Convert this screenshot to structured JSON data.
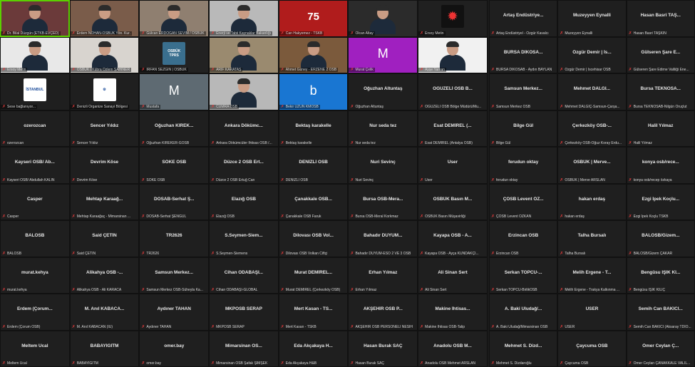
{
  "meeting": {
    "left_tiles": [
      {
        "name": "",
        "sub": "Dr. Bilal Düzgün (ETKB-EVÇED)",
        "kind": "person",
        "bg": "#6b3a3a",
        "active": true,
        "icon": "person-silhouette"
      },
      {
        "name": "",
        "sub": "Erdem NOHAN-OSBÜK Yön. Kur.",
        "kind": "person",
        "bg": "#7a5c4a",
        "icon": "person-silhouette"
      },
      {
        "name": "",
        "sub": "Gülcan ERDOĞAN SEVİM / OSBÜK",
        "kind": "person",
        "bg": "#8f7f70",
        "icon": "person-silhouette"
      },
      {
        "name": "",
        "sub": "Enerji ve Tabii Kaynaklar Bakanlığı",
        "kind": "person",
        "bg": "#b9b9b9",
        "icon": "person-silhouette"
      },
      {
        "name": "",
        "sub": "Can Hakyemez - TSKB",
        "kind": "logo",
        "bg": "#b01c1c",
        "logo": "75",
        "icon": "anniversary-logo"
      },
      {
        "name": "",
        "sub": "Olcan Altay",
        "kind": "person",
        "bg": "#2b2b2b",
        "icon": "person-silhouette"
      },
      {
        "name": "",
        "sub": "Ersoy Metin",
        "kind": "logo",
        "bg": "#202020",
        "logo": "✹",
        "icon": "emblem-logo"
      },
      {
        "name": "",
        "sub": "Ersoy Metin",
        "kind": "person",
        "bg": "#e8e8e8",
        "icon": "person-silhouette"
      },
      {
        "name": "",
        "sub": "OSBÜK | Kübra Özlem ŞAHİNER",
        "kind": "person",
        "bg": "#d8d4cf",
        "icon": "person-silhouette"
      },
      {
        "name": "",
        "sub": "İRFAN SEZGİN | OSBÜK",
        "kind": "logo",
        "bg": "#222",
        "logo": "OSBÜK TPRS",
        "icon": "osbuk-logo"
      },
      {
        "name": "",
        "sub": "ARİF KARATAŞ",
        "kind": "person",
        "bg": "#9a8a6f",
        "icon": "person-silhouette"
      },
      {
        "name": "",
        "sub": "Ahmet Güney - ERZENE 2 OSB",
        "kind": "person",
        "bg": "#7b5a3c",
        "icon": "person-silhouette"
      },
      {
        "name": "",
        "sub": "Murat Çelik",
        "kind": "avatar",
        "bg": "#a020c0",
        "letter": "M",
        "icon": "letter-avatar"
      },
      {
        "name": "",
        "sub": "Ayşe Yaman",
        "kind": "person",
        "bg": "#f1f1f1",
        "icon": "person-silhouette"
      },
      {
        "name": "",
        "sub": "Sese bağlanıyor...",
        "kind": "logo",
        "bg": "#1f1f1f",
        "logo": "İSTANBUL",
        "icon": "istanbul-osb-logo"
      },
      {
        "name": "",
        "sub": "Denizli Organize Sanayi Bölgesi",
        "kind": "logo",
        "bg": "#1f1f1f",
        "logo": "⚙",
        "icon": "gear-logo"
      },
      {
        "name": "",
        "sub": "Mustafa",
        "kind": "avatar",
        "bg": "#5e6a72",
        "letter": "M",
        "icon": "letter-avatar"
      },
      {
        "name": "",
        "sub": "CUMRA OSB",
        "kind": "person",
        "bg": "#b8b8b8",
        "icon": "person-silhouette"
      },
      {
        "name": "",
        "sub": "Bekir UZUN KMOSB",
        "kind": "avatar",
        "bg": "#1976d2",
        "letter": "b",
        "icon": "letter-avatar"
      },
      {
        "name": "Oğuzhan Altuntaş",
        "sub": "Oğuzhan Altuntaş",
        "kind": "text"
      },
      {
        "name": "OĞUZELİ OSB B...",
        "sub": "OĞUZELİ OSB Bölge Müdürü/Mu...",
        "kind": "text"
      },
      {
        "name": "ozerozcan",
        "sub": "ozerozcan",
        "kind": "text"
      },
      {
        "name": "Sencer Yıldız",
        "sub": "Sencer Yıldız",
        "kind": "text"
      },
      {
        "name": "Oğuzhan KIREK...",
        "sub": "Oğuzhan KIREKER-GOSB",
        "kind": "text"
      },
      {
        "name": "Ankara Dökümc...",
        "sub": "Ankara Dökümcüler İhtisas OSB /...",
        "kind": "text"
      },
      {
        "name": "Bektaş karakelle",
        "sub": "Bektaş karakelle",
        "kind": "text"
      },
      {
        "name": "Nur seda tez",
        "sub": "Nur seda tez",
        "kind": "text"
      },
      {
        "name": "Esat DEMİREL (...",
        "sub": "Esat DEMİREL (Antalya OSB)",
        "kind": "text"
      },
      {
        "name": "Kayseri OSB/ Ab...",
        "sub": "Kayseri OSB/ Abdullah KALIN",
        "kind": "text"
      },
      {
        "name": "Devrim Köse",
        "sub": "Devrim Köse",
        "kind": "text"
      },
      {
        "name": "SÖKE OSB",
        "sub": "SÖKE OSB",
        "kind": "text"
      },
      {
        "name": "Düzce 2 OSB Ert...",
        "sub": "Düzce 2 OSB Ertuğ Can",
        "kind": "text"
      },
      {
        "name": "DENİZLİ OSB",
        "sub": "DENİZLİ OSB",
        "kind": "text"
      },
      {
        "name": "Nuri Sevinç",
        "sub": "Nuri Sevinç",
        "kind": "text"
      },
      {
        "name": "User",
        "sub": "User",
        "kind": "text"
      },
      {
        "name": "Casper",
        "sub": "Casper",
        "kind": "text"
      },
      {
        "name": "Mehtap Karaağ...",
        "sub": "Mehtap Karaağaç - Mimarsinan ...",
        "kind": "text"
      },
      {
        "name": "DOSAB-Serhat Ş...",
        "sub": "DOSAB-Serhat ŞENGÜL",
        "kind": "text"
      },
      {
        "name": "Elazığ OSB",
        "sub": "Elazığ OSB",
        "kind": "text"
      },
      {
        "name": "Çanakkale OSB...",
        "sub": "Çanakkale OSB Faruk",
        "kind": "text"
      },
      {
        "name": "Bursa OSB-Mera...",
        "sub": "Bursa OSB-Meral Korkmaz",
        "kind": "text"
      },
      {
        "name": "OSBÜK Basın M...",
        "sub": "OSBÜK Basın Müşavirliği",
        "kind": "text"
      },
      {
        "name": "BALOSB",
        "sub": "BALOSB",
        "kind": "text"
      },
      {
        "name": "Said ÇETİN",
        "sub": "Said ÇETİN",
        "kind": "text"
      },
      {
        "name": "TR2626",
        "sub": "TR2626",
        "kind": "text"
      },
      {
        "name": "S.Seymen-Siem...",
        "sub": "S.Seymen-Siemens",
        "kind": "text"
      },
      {
        "name": "Dilovası OSB Vol...",
        "sub": "Dilovası OSB Volkan Ciftçi",
        "kind": "text"
      },
      {
        "name": "Bahadır DUYUM...",
        "sub": "Bahadır DUYUM-ESO 2 VE 3 OSB",
        "kind": "text"
      },
      {
        "name": "Kayapa OSB - A...",
        "sub": "Kayapa OSB - Ayça KUNDAKÇI...",
        "kind": "text"
      },
      {
        "name": "murat.kehya",
        "sub": "murat.kehya",
        "kind": "text"
      },
      {
        "name": "Alikahya OSB -...",
        "sub": "Alikahya OSB - Ali KARACA",
        "kind": "text"
      },
      {
        "name": "Samsun Merkez...",
        "sub": "Samsun Merkez OSB-Süheyla Ka...",
        "kind": "text"
      },
      {
        "name": "Cihan ODABAŞI...",
        "sub": "Cihan ODABAŞI-GLOBAL",
        "kind": "text"
      },
      {
        "name": "Murat DEMİREL...",
        "sub": "Murat DEMİREL (Çerkezköy OSB)",
        "kind": "text"
      },
      {
        "name": "Erhan Yılmaz",
        "sub": "Erhan Yılmaz",
        "kind": "text"
      },
      {
        "name": "Ali Sinan Sert",
        "sub": "Ali Sinan Sert",
        "kind": "text"
      },
      {
        "name": "Erdem (Çorum...",
        "sub": "Erdem (Çorum OSB)",
        "kind": "text"
      },
      {
        "name": "M. Anıl KABACA...",
        "sub": "M. Anıl KABACAN (IU)",
        "kind": "text"
      },
      {
        "name": "Aydıner TAHAN",
        "sub": "Aydıner TAHAN",
        "kind": "text"
      },
      {
        "name": "MKPOSB SERAP",
        "sub": "MKPOSB SERAP",
        "kind": "text"
      },
      {
        "name": "Mert Kasan - TS...",
        "sub": "Mert Kasan - TSKB",
        "kind": "text"
      },
      {
        "name": "AKŞEHİR OSB P...",
        "sub": "AKŞEHİR OSB PERSONELİ NESİH",
        "kind": "text"
      },
      {
        "name": "Makine İhtisas...",
        "sub": "Makine İhtisas OSB-Talip",
        "kind": "text"
      },
      {
        "name": "Meltem Ucal",
        "sub": "Meltem Ucal",
        "kind": "text"
      },
      {
        "name": "BABAYIGITM",
        "sub": "BABAYIGITM",
        "kind": "text"
      },
      {
        "name": "omer.bay",
        "sub": "omer.bay",
        "kind": "text"
      },
      {
        "name": "Mimarsinan OS...",
        "sub": "Mimarsinan OSB Şafak ŞİMŞEK",
        "kind": "text"
      },
      {
        "name": "Eda Akçakaya H...",
        "sub": "Eda Akçakaya H&B",
        "kind": "text"
      },
      {
        "name": "Hasan Burak SAÇ",
        "sub": "Hasan Burak SAÇ",
        "kind": "text"
      },
      {
        "name": "Anadolu OSB M...",
        "sub": "Anadolu OSB Mehmet ARSLAN",
        "kind": "text"
      }
    ],
    "right_tiles": [
      {
        "name": "Artaş Endüstriye...",
        "sub": "Artaş Endüstriyel - Özgür Kavalcı"
      },
      {
        "name": "Muzeyyen Eynalli",
        "sub": "Muzeyyen Eynalli"
      },
      {
        "name": "Hasan Basri TAŞ...",
        "sub": "Hasan Basri TAŞKIN"
      },
      {
        "name": "BURSA DİKOSA...",
        "sub": "BURSA DİKOSAB - Aydın BAYLAN"
      },
      {
        "name": "Özgür Demir | İs...",
        "sub": "Özgür Demir | İscehisar OSB"
      },
      {
        "name": "Gülseren Şare E...",
        "sub": "Gülseren Şare Edirne Valiliği Ene..."
      },
      {
        "name": "Samsun Merkez...",
        "sub": "Samsun Merkez OSB"
      },
      {
        "name": "Mehmet DALGI...",
        "sub": "Mehmet DALGIÇ-Samsun-Çarşa..."
      },
      {
        "name": "Bursa TEKNOSA...",
        "sub": "Bursa TEKNOSAB-Nilgün Oruçlut"
      },
      {
        "name": "Bilge Gül",
        "sub": "Bilge Gül"
      },
      {
        "name": "Çerkezköy OSB-...",
        "sub": "Çerkezköy OSB-Oğuz Koray Erdu..."
      },
      {
        "name": "Halil Yılmaz",
        "sub": "Halil Yılmaz"
      },
      {
        "name": "ferudun oktay",
        "sub": "ferudun oktay"
      },
      {
        "name": "OSBÜK | Merve...",
        "sub": "OSBÜK | Merve ARSLAN"
      },
      {
        "name": "konya osb/rece...",
        "sub": "konya osb/recep özkaya"
      },
      {
        "name": "ÇOSB Levent ÖZ...",
        "sub": "ÇOSB Levent ÖZKAN"
      },
      {
        "name": "hakan erdaş",
        "sub": "hakan erdaş"
      },
      {
        "name": "Ezgi İpek Koçlu...",
        "sub": "Ezgi İpek Koçlu TSKB"
      },
      {
        "name": "Erzincan OSB",
        "sub": "Erzincan OSB"
      },
      {
        "name": "Talha Bursalı",
        "sub": "Talha Bursalı"
      },
      {
        "name": "BALOSB/Gizem...",
        "sub": "BALOSB/Gizem ÇAKAR"
      },
      {
        "name": "Serkan TOPCU-...",
        "sub": "Serkan TOPCU-BirlikOSB"
      },
      {
        "name": "Melih Ergene - T...",
        "sub": "Melih Ergene - Trakya Kalkınma ..."
      },
      {
        "name": "Bengüsu IŞIK KI...",
        "sub": "Bengüsu IŞIK KILIÇ"
      },
      {
        "name": "A. Baki Uludağ/...",
        "sub": "A. Baki Uludağ/Mimarsinan OSB"
      },
      {
        "name": "USER",
        "sub": "USER"
      },
      {
        "name": "Semih Can BAKICI...",
        "sub": "Semih Can BAKICI (Aksaray TDİO..."
      },
      {
        "name": "Mehmet S. Dizd...",
        "sub": "Mehmet S. Dizdaroğlu"
      },
      {
        "name": "Çaycuma OSB",
        "sub": "Çaycuma OSB"
      },
      {
        "name": "Ömer Ceylan Ç...",
        "sub": "Ömer Ceylan ÇANAKKALE VALİL..."
      }
    ],
    "muted_icon": "muted-microphone-icon"
  }
}
